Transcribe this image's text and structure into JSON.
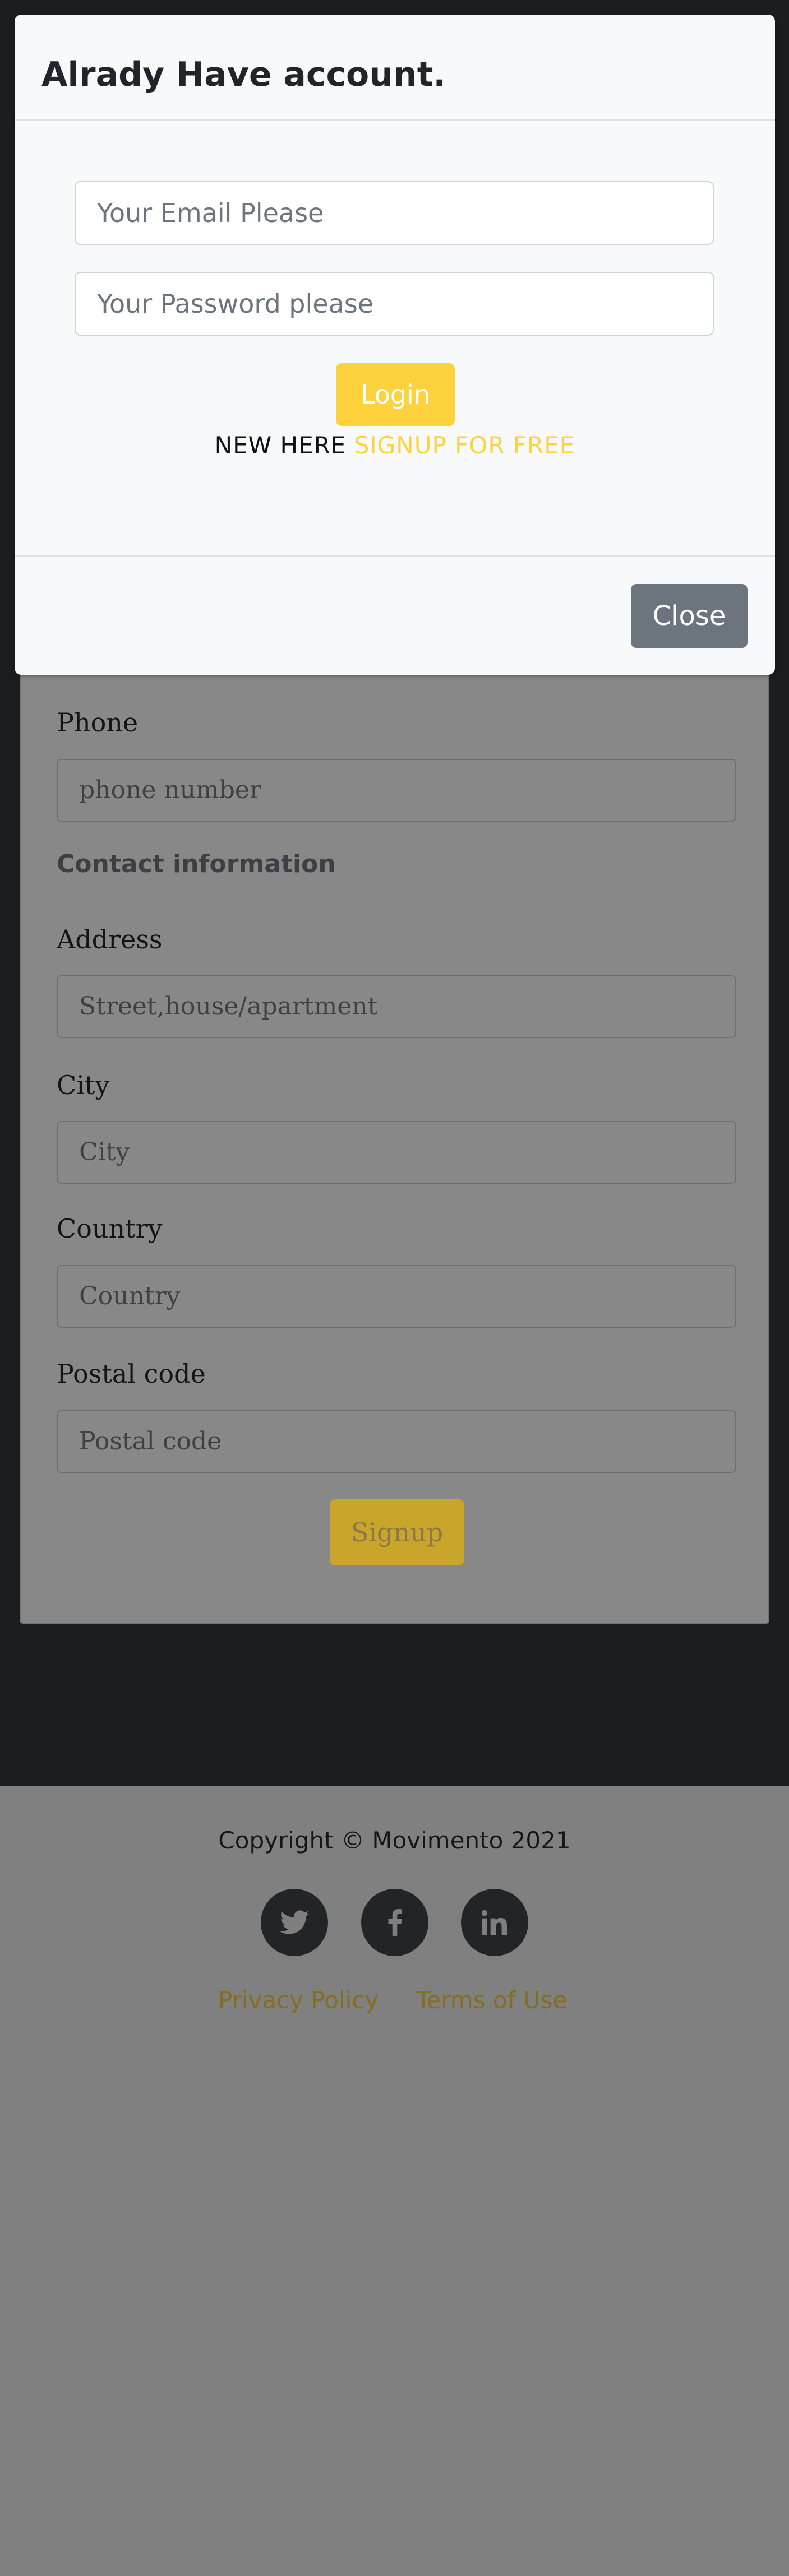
{
  "modal": {
    "title": "Alrady Have account.",
    "email_placeholder": "Your Email Please",
    "password_placeholder": "Your Password please",
    "login_label": "Login",
    "newhere_text": "NEW HERE",
    "signup_link": "SIGNUP FOR FREE",
    "close_label": "Close"
  },
  "form": {
    "phone_label": "Phone",
    "phone_placeholder": "phone number",
    "contact_title": "Contact information",
    "address_label": "Address",
    "address_placeholder": "Street,house/apartment",
    "city_label": "City",
    "city_placeholder": "City",
    "country_label": "Country",
    "country_placeholder": "Country",
    "postal_label": "Postal code",
    "postal_placeholder": "Postal code",
    "signup_label": "Signup"
  },
  "footer": {
    "copyright": "Copyright © Movimento 2021",
    "social_icons": [
      "twitter-icon",
      "facebook-icon",
      "linkedin-icon"
    ],
    "privacy": "Privacy Policy",
    "terms": "Terms of Use"
  },
  "colors": {
    "accent": "#fdd23d",
    "close_button": "#6c757d",
    "backdrop_dark": "#1b1e21",
    "footer_dimmed": "#808080"
  }
}
